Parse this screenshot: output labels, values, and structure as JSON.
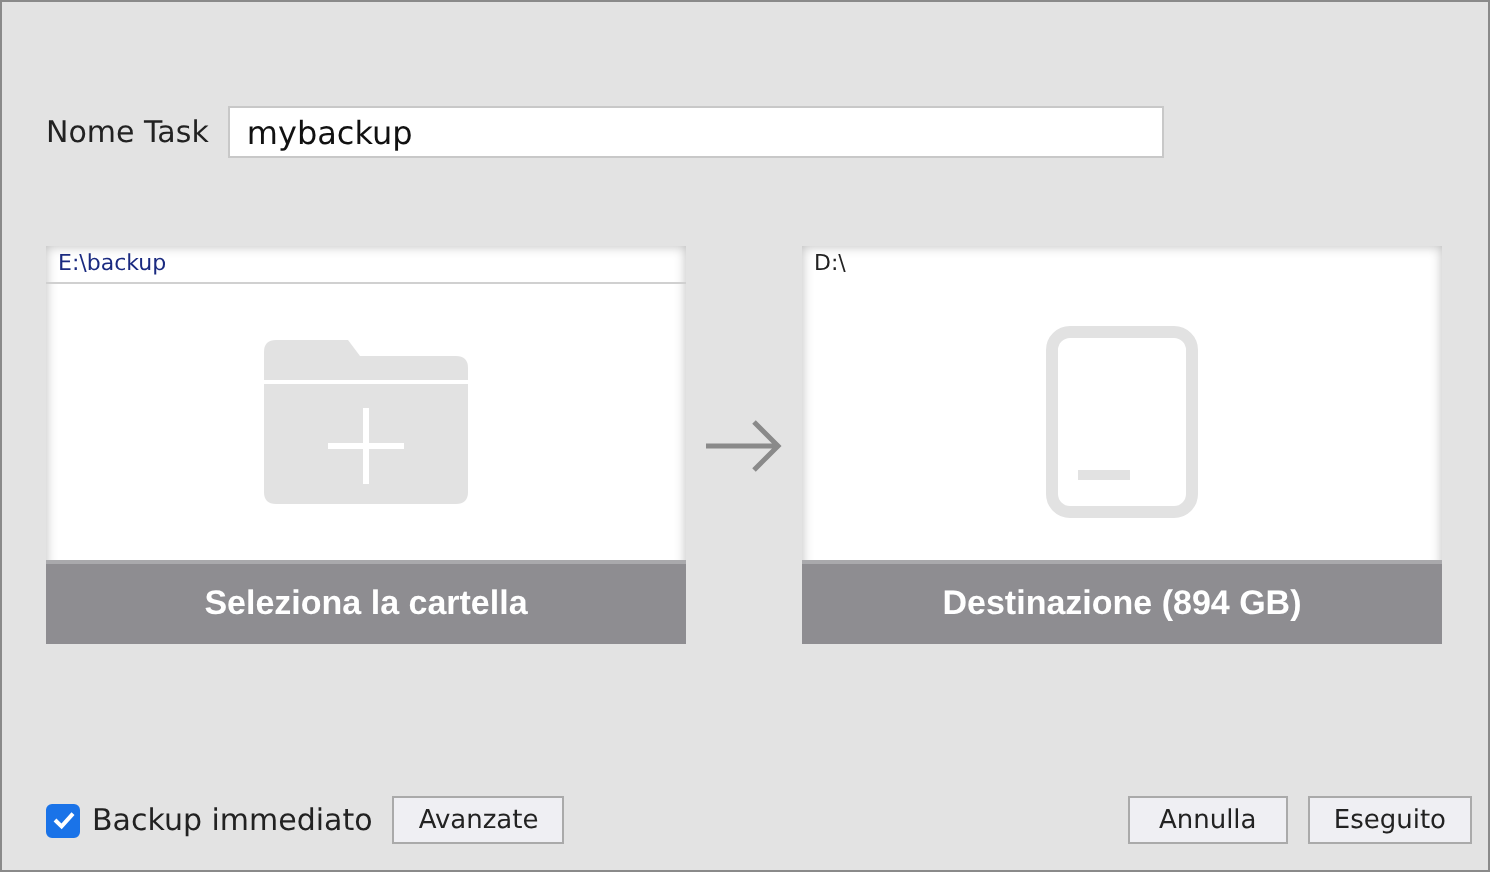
{
  "task_name": {
    "label": "Nome Task",
    "value": "mybackup"
  },
  "source": {
    "kind": "folder",
    "path": "E:\\backup",
    "caption": "Seleziona la cartella"
  },
  "destination": {
    "kind": "drive",
    "path": "D:\\",
    "caption": "Destinazione (894 GB)"
  },
  "immediate_backup": {
    "label": "Backup immediato",
    "checked": true
  },
  "buttons": {
    "advanced": "Avanzate",
    "cancel": "Annulla",
    "ok": "Eseguito"
  }
}
